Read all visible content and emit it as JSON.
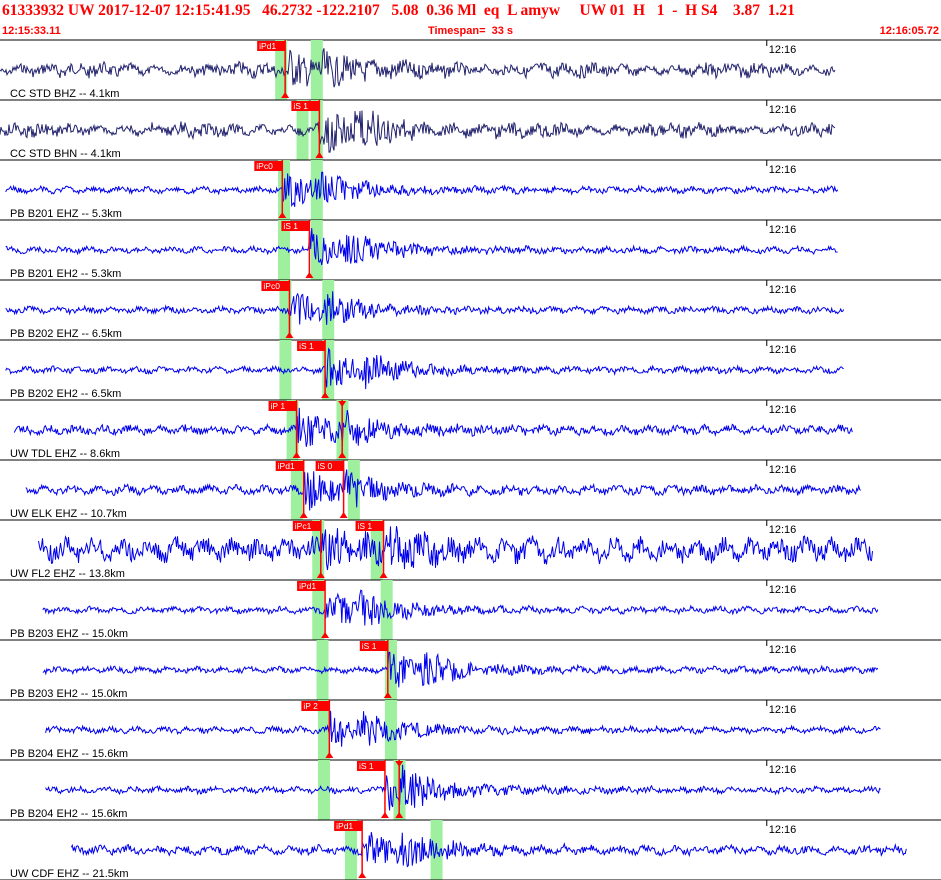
{
  "header": {
    "title": "61333932 UW 2017-12-07 12:15:41.95   46.2732 -122.2107   5.08  0.36 Ml  eq  L amyw     UW 01  H   1  -  H S4    3.87  1.21",
    "start_time": "12:15:33.11",
    "timespan": "Timespan=  33 s",
    "end_time": "12:16:05.72"
  },
  "colors": {
    "title_text": "#ff0000",
    "trace_cc": "#22226e",
    "trace_other": "#0000ee",
    "pick_flag": "#ff0000",
    "pick_window": "#9ef09e",
    "divider": "#000000"
  },
  "chart_data": {
    "type": "seismogram",
    "time_range": [
      "12:15:33.11",
      "12:16:05.72"
    ],
    "timespan_s": 33,
    "minute_tick_label": "12:16",
    "traces": [
      {
        "label": "CC STD BHZ -- 4.1km",
        "network": "CC",
        "start_s": 0.0,
        "end_s": 29.3,
        "picks": [
          {
            "label": "iPd1",
            "t_s": 10.0
          }
        ],
        "windows_s": [
          9.65,
          10.9
        ]
      },
      {
        "label": "CC STD BHN -- 4.1km",
        "network": "CC",
        "start_s": 0.0,
        "end_s": 29.3,
        "picks": [
          {
            "label": "iS 1",
            "t_s": 11.2
          }
        ],
        "windows_s": [
          10.4,
          10.9
        ]
      },
      {
        "label": "PB B201 EHZ -- 5.3km",
        "network": "PB",
        "start_s": 0.2,
        "end_s": 29.4,
        "picks": [
          {
            "label": "iPc0",
            "t_s": 9.9
          }
        ],
        "windows_s": [
          9.75,
          10.9
        ]
      },
      {
        "label": "PB B201 EH2 -- 5.3km",
        "network": "PB",
        "start_s": 0.2,
        "end_s": 29.4,
        "picks": [
          {
            "label": "iS 1",
            "t_s": 10.85
          }
        ],
        "windows_s": [
          9.75,
          10.9
        ]
      },
      {
        "label": "PB B202 EHZ -- 6.5km",
        "network": "PB",
        "start_s": 0.2,
        "end_s": 29.6,
        "picks": [
          {
            "label": "iPc0",
            "t_s": 10.15
          }
        ],
        "windows_s": [
          9.8,
          11.3
        ]
      },
      {
        "label": "PB B202 EH2 -- 6.5km",
        "network": "PB",
        "start_s": 0.2,
        "end_s": 29.6,
        "picks": [
          {
            "label": "iS 1",
            "t_s": 11.4
          }
        ],
        "windows_s": [
          9.8,
          11.3
        ]
      },
      {
        "label": "UW TDL EHZ -- 8.6km",
        "network": "UW",
        "start_s": 0.5,
        "end_s": 29.9,
        "picks": [
          {
            "label": "iP 1",
            "t_s": 10.4
          },
          {
            "label": "",
            "t_s": 12.0
          }
        ],
        "windows_s": [
          10.05,
          11.8
        ]
      },
      {
        "label": "UW ELK EHZ -- 10.7km",
        "network": "UW",
        "start_s": 0.9,
        "end_s": 30.2,
        "picks": [
          {
            "label": "iPd1",
            "t_s": 10.65
          },
          {
            "label": "iS 0",
            "t_s": 12.05
          }
        ],
        "windows_s": [
          10.2,
          12.2
        ]
      },
      {
        "label": "UW FL2 EHZ -- 13.8km",
        "network": "UW",
        "start_s": 1.35,
        "end_s": 30.6,
        "picks": [
          {
            "label": "iPc1",
            "t_s": 11.25
          },
          {
            "label": "iS 1",
            "t_s": 13.45
          }
        ],
        "windows_s": [
          10.95,
          13.0
        ]
      },
      {
        "label": "PB B203 EHZ -- 15.0km",
        "network": "PB",
        "start_s": 1.5,
        "end_s": 30.8,
        "picks": [
          {
            "label": "iPd1",
            "t_s": 11.4
          }
        ],
        "windows_s": [
          10.95,
          13.35
        ]
      },
      {
        "label": "PB B203 EH2 -- 15.0km",
        "network": "PB",
        "start_s": 1.5,
        "end_s": 30.8,
        "picks": [
          {
            "label": "iS 1",
            "t_s": 13.6
          }
        ],
        "windows_s": [
          11.1,
          13.5
        ]
      },
      {
        "label": "PB B204 EHZ -- 15.6km",
        "network": "PB",
        "start_s": 1.6,
        "end_s": 30.9,
        "picks": [
          {
            "label": "iP 2",
            "t_s": 11.55
          }
        ],
        "windows_s": [
          11.15,
          13.5
        ]
      },
      {
        "label": "PB B204 EH2 -- 15.6km",
        "network": "PB",
        "start_s": 1.6,
        "end_s": 30.9,
        "picks": [
          {
            "label": "iS 1",
            "t_s": 13.5
          },
          {
            "label": "",
            "t_s": 14.0
          }
        ],
        "windows_s": [
          11.15,
          13.8
        ]
      },
      {
        "label": "UW CDF EHZ -- 21.5km",
        "network": "UW",
        "start_s": 2.5,
        "end_s": 31.8,
        "picks": [
          {
            "label": "iPd1",
            "t_s": 12.7
          }
        ],
        "windows_s": [
          12.1,
          15.1
        ]
      }
    ]
  }
}
